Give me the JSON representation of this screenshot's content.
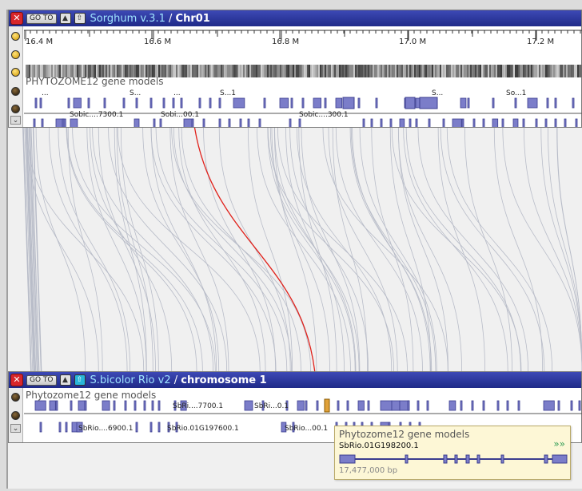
{
  "top_panel": {
    "goto_label": "GO TO",
    "species": "Sorghum v.3.1",
    "separator": "/",
    "chromosome": "Chr01",
    "ruler_ticks": [
      "16.4 M",
      "16.6 M",
      "16.8 M",
      "17.0 M",
      "17.2 M"
    ],
    "track_label": "PHYTOZOME12 gene models",
    "gene_labels_row1": [
      "...",
      "S...",
      "...",
      "S...1",
      "S...",
      "So...1"
    ],
    "gene_labels_row2": [
      "Sobic....7300.1",
      "Sobi...00.1",
      "Sobic....300.1"
    ]
  },
  "bottom_panel": {
    "goto_label": "GO TO",
    "species": "S.bicolor Rio v2",
    "separator": "/",
    "chromosome": "chromosome 1",
    "track_label": "Phytozome12 gene models",
    "gene_labels_row1": [
      "SbRi....7700.1",
      "SbRi...0.1"
    ],
    "gene_labels_row2": [
      "SbRio....6900.1",
      "SbRio.01G197600.1",
      "SbRio...00.1"
    ]
  },
  "tooltip": {
    "title": "Phytozome12 gene models",
    "gene_id": "SbRio.01G198200.1",
    "position": "17,477,000 bp",
    "more_icon": "double-chevron-right-icon"
  },
  "colors": {
    "title_bar": "#2a35a0",
    "gene_fill": "#7b7dc9",
    "gene_border": "#3b3d8f",
    "highlight_link": "#e0201a",
    "synteny_lines": "#b8bcc8",
    "tooltip_bg": "#fdf7d6"
  }
}
